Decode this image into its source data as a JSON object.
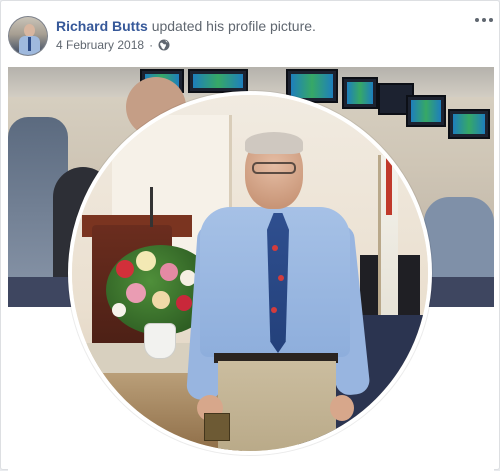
{
  "post": {
    "author": "Richard Butts",
    "action": "updated his profile picture.",
    "date": "4 February 2018",
    "separator": "·",
    "privacy_icon": "globe-icon",
    "more_icon": "more-options-icon"
  },
  "colors": {
    "author_link": "#365899",
    "secondary_text": "#606770",
    "card_background": "#ffffff",
    "page_background": "#e9ebee"
  },
  "media": {
    "cover_photo": "cover-photo",
    "profile_picture": "profile-picture"
  }
}
